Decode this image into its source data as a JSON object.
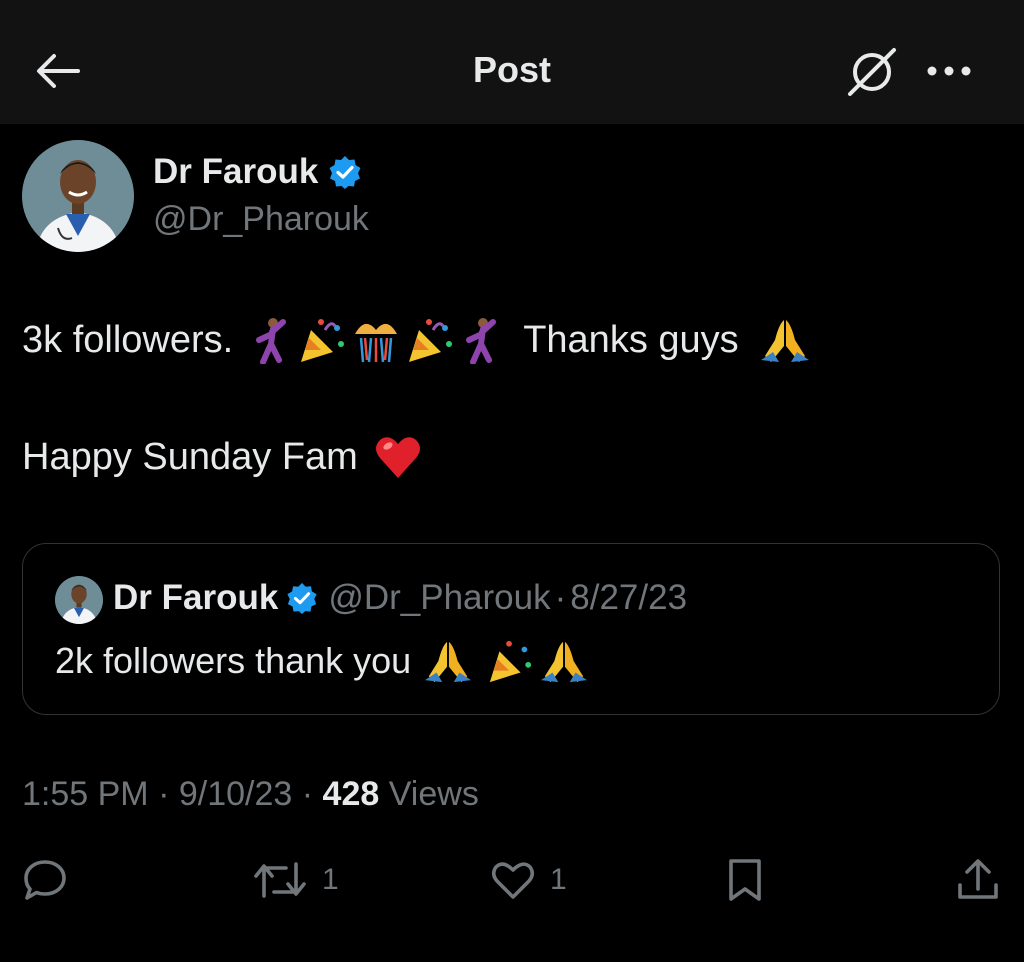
{
  "header": {
    "title": "Post"
  },
  "author": {
    "name": "Dr Farouk",
    "handle": "@Dr_Pharouk",
    "verified": true
  },
  "tweet": {
    "line1_text": "3k followers.",
    "line1_suffix": "Thanks guys",
    "line2_text": "Happy Sunday Fam",
    "emojis_line1": [
      "man-dancing",
      "party-popper",
      "confetti-ball",
      "party-popper",
      "man-dancing"
    ],
    "emoji_end_line1": "folded-hands",
    "emoji_end_line2": "red-heart"
  },
  "quote": {
    "name": "Dr Farouk",
    "handle": "@Dr_Pharouk",
    "separator": "·",
    "date": "8/27/23",
    "text": "2k followers thank you",
    "emojis": [
      "folded-hands",
      "party-popper",
      "folded-hands"
    ]
  },
  "meta": {
    "time": "1:55 PM",
    "separator": "·",
    "date": "9/10/23",
    "views_count": "428",
    "views_label": "Views"
  },
  "actions": {
    "reply_count": "",
    "repost_count": "1",
    "like_count": "1"
  },
  "colors": {
    "background": "#000000",
    "header_background": "#121212",
    "text": "#e7e9ea",
    "secondary_text": "#71767b",
    "verified_badge": "#1d9bf0",
    "border": "#2f3336"
  }
}
